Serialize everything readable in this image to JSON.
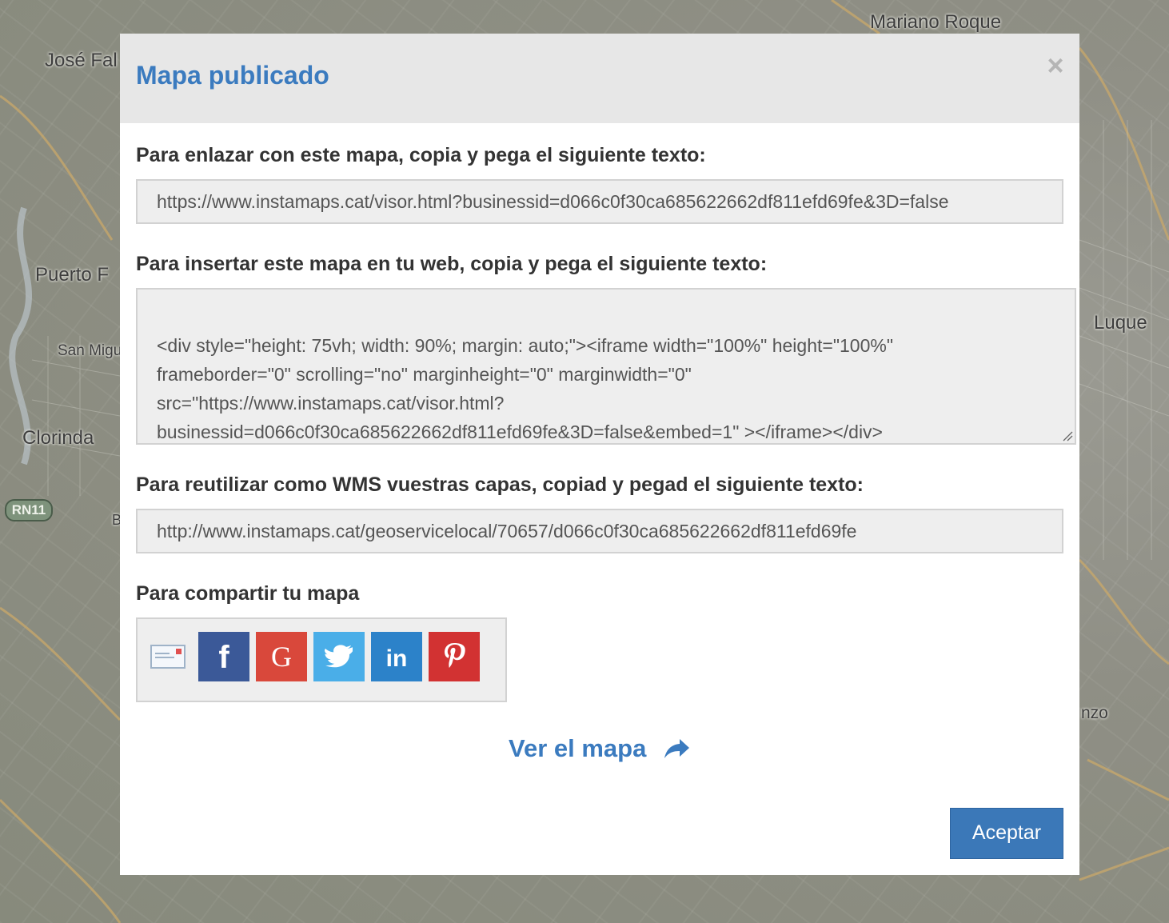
{
  "map": {
    "labels": {
      "mariano_roque": "Mariano Roque",
      "jose_fal": "José Fal",
      "puerto_f": "Puerto F",
      "san_mig": "San Migu",
      "clorinda": "Clorinda",
      "luque": "Luque",
      "enzo": "nzo",
      "route_badge": "RN11",
      "b": "B"
    }
  },
  "modal": {
    "title": "Mapa publicado",
    "close_symbol": "×",
    "link_section": {
      "label": "Para enlazar con este mapa, copia y pega el siguiente texto:",
      "value": "https://www.instamaps.cat/visor.html?businessid=d066c0f30ca685622662df811efd69fe&3D=false"
    },
    "embed_section": {
      "label": "Para insertar este mapa en tu web, copia y pega el siguiente texto:",
      "value": "<div style=\"height: 75vh; width: 90%; margin: auto;\"><iframe width=\"100%\" height=\"100%\"\nframeborder=\"0\" scrolling=\"no\" marginheight=\"0\" marginwidth=\"0\"\nsrc=\"https://www.instamaps.cat/visor.html?\nbusinessid=d066c0f30ca685622662df811efd69fe&3D=false&embed=1\" ></iframe></div>"
    },
    "wms_section": {
      "label": "Para reutilizar como WMS vuestras capas, copiad y pegad el siguiente texto:",
      "value": "http://www.instamaps.cat/geoservicelocal/70657/d066c0f30ca685622662df811efd69fe"
    },
    "share_section": {
      "label": "Para compartir tu mapa",
      "buttons": [
        {
          "name": "email",
          "icon": "email-icon",
          "color": "#eef2f6"
        },
        {
          "name": "facebook",
          "icon": "facebook-icon",
          "glyph": "f",
          "color": "#3b5998"
        },
        {
          "name": "google",
          "icon": "google-icon",
          "glyph": "G",
          "color": "#d9483b"
        },
        {
          "name": "twitter",
          "icon": "twitter-icon",
          "color": "#4aaee8"
        },
        {
          "name": "linkedin",
          "icon": "linkedin-icon",
          "glyph": "in",
          "color": "#2c82c9"
        },
        {
          "name": "pinterest",
          "icon": "pinterest-icon",
          "glyph": "P",
          "color": "#d23232"
        }
      ]
    },
    "view_link": "Ver el mapa",
    "accept_button": "Aceptar"
  },
  "colors": {
    "accent": "#3b7bbf",
    "button": "#3b78b8",
    "header_bg": "#e7e7e7",
    "field_bg": "#eeeeee"
  }
}
